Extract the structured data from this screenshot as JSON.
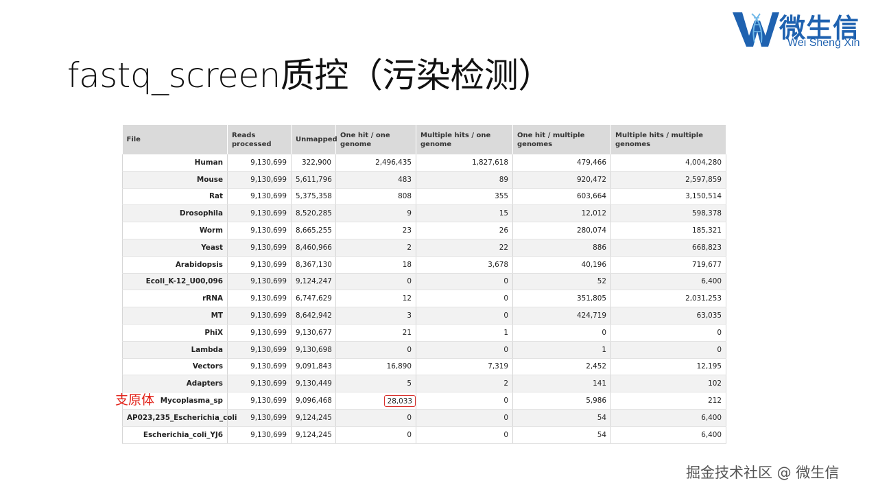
{
  "slide": {
    "title": "fastq_screen质控（污染检测）"
  },
  "logo": {
    "cn": "微生信",
    "en": "Wei Sheng Xin",
    "brand_color": "#1f62b0"
  },
  "table": {
    "headers": [
      "File",
      "Reads processed",
      "Unmapped",
      "One hit / one genome",
      "Multiple hits / one genome",
      "One hit / multiple genomes",
      "Multiple hits / multiple genomes"
    ],
    "rows": [
      [
        "Human",
        "9,130,699",
        "322,900",
        "2,496,435",
        "1,827,618",
        "479,466",
        "4,004,280"
      ],
      [
        "Mouse",
        "9,130,699",
        "5,611,796",
        "483",
        "89",
        "920,472",
        "2,597,859"
      ],
      [
        "Rat",
        "9,130,699",
        "5,375,358",
        "808",
        "355",
        "603,664",
        "3,150,514"
      ],
      [
        "Drosophila",
        "9,130,699",
        "8,520,285",
        "9",
        "15",
        "12,012",
        "598,378"
      ],
      [
        "Worm",
        "9,130,699",
        "8,665,255",
        "23",
        "26",
        "280,074",
        "185,321"
      ],
      [
        "Yeast",
        "9,130,699",
        "8,460,966",
        "2",
        "22",
        "886",
        "668,823"
      ],
      [
        "Arabidopsis",
        "9,130,699",
        "8,367,130",
        "18",
        "3,678",
        "40,196",
        "719,677"
      ],
      [
        "Ecoli_K-12_U00,096",
        "9,130,699",
        "9,124,247",
        "0",
        "0",
        "52",
        "6,400"
      ],
      [
        "rRNA",
        "9,130,699",
        "6,747,629",
        "12",
        "0",
        "351,805",
        "2,031,253"
      ],
      [
        "MT",
        "9,130,699",
        "8,642,942",
        "3",
        "0",
        "424,719",
        "63,035"
      ],
      [
        "PhiX",
        "9,130,699",
        "9,130,677",
        "21",
        "1",
        "0",
        "0"
      ],
      [
        "Lambda",
        "9,130,699",
        "9,130,698",
        "0",
        "0",
        "1",
        "0"
      ],
      [
        "Vectors",
        "9,130,699",
        "9,091,843",
        "16,890",
        "7,319",
        "2,452",
        "12,195"
      ],
      [
        "Adapters",
        "9,130,699",
        "9,130,449",
        "5",
        "2",
        "141",
        "102"
      ],
      [
        "Mycoplasma_sp",
        "9,130,699",
        "9,096,468",
        "28,033",
        "0",
        "5,986",
        "212"
      ],
      [
        "AP023,235_Escherichia_coli",
        "9,130,699",
        "9,124,245",
        "0",
        "0",
        "54",
        "6,400"
      ],
      [
        "Escherichia_coli_YJ6",
        "9,130,699",
        "9,124,245",
        "0",
        "0",
        "54",
        "6,400"
      ]
    ],
    "highlight": {
      "row": 14,
      "col": 3,
      "color": "#d9302c"
    }
  },
  "annotation": {
    "text": "支原体",
    "color": "#e2231a"
  },
  "watermark": {
    "text": "掘金技术社区 @ 微生信"
  }
}
